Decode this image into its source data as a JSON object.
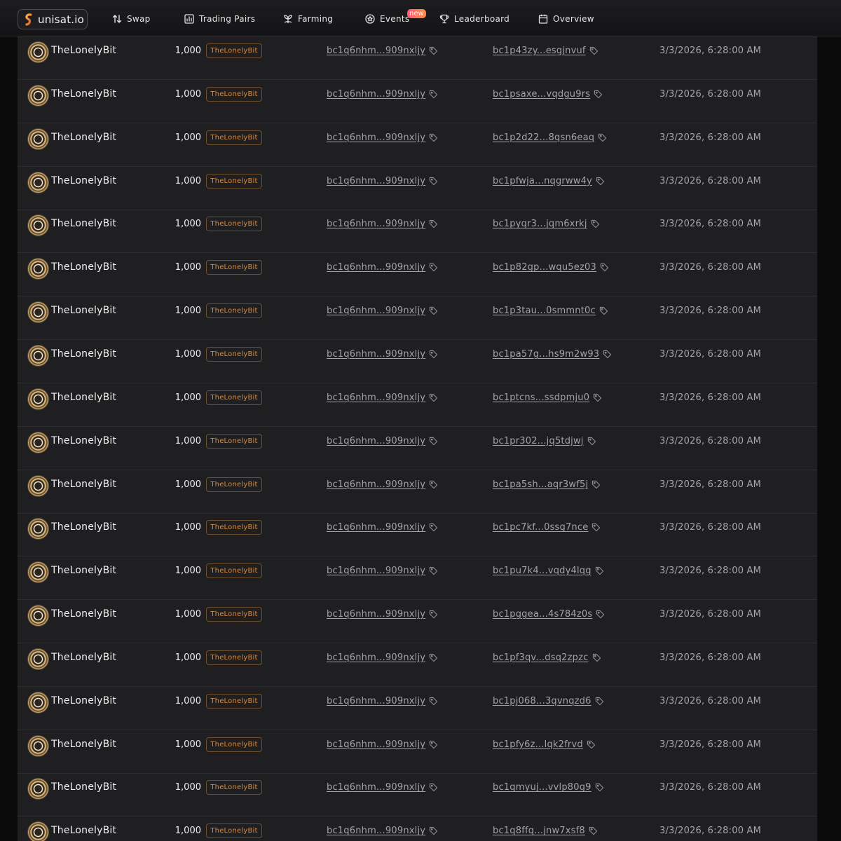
{
  "header": {
    "logo_text": "unisat.io",
    "nav": [
      {
        "label": "Swap",
        "icon": "swap-arrows-icon"
      },
      {
        "label": "Trading Pairs",
        "icon": "bar-chart-icon"
      },
      {
        "label": "Farming",
        "icon": "sprout-icon"
      },
      {
        "label": "Events",
        "icon": "events-badge-icon",
        "badge": "new"
      },
      {
        "label": "Leaderboard",
        "icon": "trophy-icon"
      },
      {
        "label": "Overview",
        "icon": "calendar-icon"
      }
    ]
  },
  "colors": {
    "accent": "#d98a3d",
    "row_bg": "#1f1f22",
    "page_bg": "#0b0b0c",
    "badge_gradient": [
      "#ff5a7a",
      "#ff8a3d"
    ]
  },
  "rows": [
    {
      "name": "TheLonelyBit",
      "amount": "1,000",
      "tick": "TheLonelyBit",
      "from": "bc1q6nhm...909nxljy",
      "to": "bc1p43zy...esgjnvuf",
      "time": "3/3/2026, 6:28:00 AM"
    },
    {
      "name": "TheLonelyBit",
      "amount": "1,000",
      "tick": "TheLonelyBit",
      "from": "bc1q6nhm...909nxljy",
      "to": "bc1psaxe...vqdgu9rs",
      "time": "3/3/2026, 6:28:00 AM"
    },
    {
      "name": "TheLonelyBit",
      "amount": "1,000",
      "tick": "TheLonelyBit",
      "from": "bc1q6nhm...909nxljy",
      "to": "bc1p2d22...8qsn6eaq",
      "time": "3/3/2026, 6:28:00 AM"
    },
    {
      "name": "TheLonelyBit",
      "amount": "1,000",
      "tick": "TheLonelyBit",
      "from": "bc1q6nhm...909nxljy",
      "to": "bc1pfwja...nqgrww4y",
      "time": "3/3/2026, 6:28:00 AM"
    },
    {
      "name": "TheLonelyBit",
      "amount": "1,000",
      "tick": "TheLonelyBit",
      "from": "bc1q6nhm...909nxljy",
      "to": "bc1pyqr3...jqm6xrkj",
      "time": "3/3/2026, 6:28:00 AM"
    },
    {
      "name": "TheLonelyBit",
      "amount": "1,000",
      "tick": "TheLonelyBit",
      "from": "bc1q6nhm...909nxljy",
      "to": "bc1p82gp...wqu5ez03",
      "time": "3/3/2026, 6:28:00 AM"
    },
    {
      "name": "TheLonelyBit",
      "amount": "1,000",
      "tick": "TheLonelyBit",
      "from": "bc1q6nhm...909nxljy",
      "to": "bc1p3tau...0smmnt0c",
      "time": "3/3/2026, 6:28:00 AM"
    },
    {
      "name": "TheLonelyBit",
      "amount": "1,000",
      "tick": "TheLonelyBit",
      "from": "bc1q6nhm...909nxljy",
      "to": "bc1pa57g...hs9m2w93",
      "time": "3/3/2026, 6:28:00 AM"
    },
    {
      "name": "TheLonelyBit",
      "amount": "1,000",
      "tick": "TheLonelyBit",
      "from": "bc1q6nhm...909nxljy",
      "to": "bc1ptcns...ssdpmju0",
      "time": "3/3/2026, 6:28:00 AM"
    },
    {
      "name": "TheLonelyBit",
      "amount": "1,000",
      "tick": "TheLonelyBit",
      "from": "bc1q6nhm...909nxljy",
      "to": "bc1pr302...jq5tdjwj",
      "time": "3/3/2026, 6:28:00 AM"
    },
    {
      "name": "TheLonelyBit",
      "amount": "1,000",
      "tick": "TheLonelyBit",
      "from": "bc1q6nhm...909nxljy",
      "to": "bc1pa5sh...aqr3wf5j",
      "time": "3/3/2026, 6:28:00 AM"
    },
    {
      "name": "TheLonelyBit",
      "amount": "1,000",
      "tick": "TheLonelyBit",
      "from": "bc1q6nhm...909nxljy",
      "to": "bc1pc7kf...0ssg7nce",
      "time": "3/3/2026, 6:28:00 AM"
    },
    {
      "name": "TheLonelyBit",
      "amount": "1,000",
      "tick": "TheLonelyBit",
      "from": "bc1q6nhm...909nxljy",
      "to": "bc1pu7k4...vqdy4lqg",
      "time": "3/3/2026, 6:28:00 AM"
    },
    {
      "name": "TheLonelyBit",
      "amount": "1,000",
      "tick": "TheLonelyBit",
      "from": "bc1q6nhm...909nxljy",
      "to": "bc1pggea...4s784z0s",
      "time": "3/3/2026, 6:28:00 AM"
    },
    {
      "name": "TheLonelyBit",
      "amount": "1,000",
      "tick": "TheLonelyBit",
      "from": "bc1q6nhm...909nxljy",
      "to": "bc1pf3qv...dsq2zpzc",
      "time": "3/3/2026, 6:28:00 AM"
    },
    {
      "name": "TheLonelyBit",
      "amount": "1,000",
      "tick": "TheLonelyBit",
      "from": "bc1q6nhm...909nxljy",
      "to": "bc1pj068...3qvnqzd6",
      "time": "3/3/2026, 6:28:00 AM"
    },
    {
      "name": "TheLonelyBit",
      "amount": "1,000",
      "tick": "TheLonelyBit",
      "from": "bc1q6nhm...909nxljy",
      "to": "bc1pfy6z...lqk2frvd",
      "time": "3/3/2026, 6:28:00 AM"
    },
    {
      "name": "TheLonelyBit",
      "amount": "1,000",
      "tick": "TheLonelyBit",
      "from": "bc1q6nhm...909nxljy",
      "to": "bc1qmyuj...vvlp80g9",
      "time": "3/3/2026, 6:28:00 AM"
    },
    {
      "name": "TheLonelyBit",
      "amount": "1,000",
      "tick": "TheLonelyBit",
      "from": "bc1q6nhm...909nxljy",
      "to": "bc1q8ffq...jnw7xsf8",
      "time": "3/3/2026, 6:28:00 AM"
    }
  ]
}
